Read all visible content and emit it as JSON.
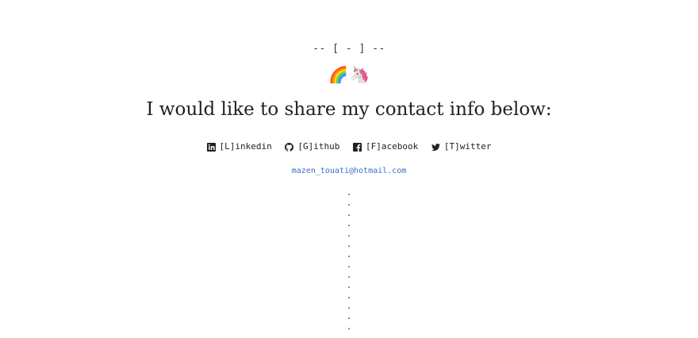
{
  "header": {
    "marker": "-- [ - ] --",
    "emojis": [
      "🌈",
      "🦄"
    ]
  },
  "headline": "I would like to share my contact info below:",
  "social": [
    {
      "label": "[L]inkedin",
      "icon": "linkedin-icon"
    },
    {
      "label": "[G]ithub",
      "icon": "github-icon"
    },
    {
      "label": "[F]acebook",
      "icon": "facebook-icon"
    },
    {
      "label": "[T]witter",
      "icon": "twitter-icon"
    }
  ],
  "email": "mazen_touati@hotmail.com",
  "dots": [
    ".",
    ".",
    ".",
    ".",
    ".",
    ".",
    ".",
    ".",
    ".",
    ".",
    ".",
    ".",
    ".",
    "."
  ],
  "colors": {
    "text": "#222222",
    "link": "#3c6fc1",
    "background": "#ffffff"
  }
}
